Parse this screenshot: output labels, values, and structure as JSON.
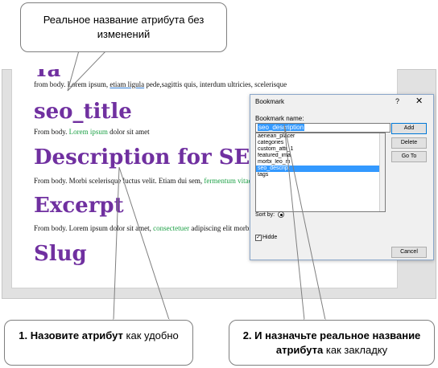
{
  "document": {
    "headings": {
      "h0": "Ya",
      "seo_title": "seo_title",
      "seo_description": "Description for SEO",
      "excerpt": "Excerpt",
      "slug": "Slug"
    },
    "lines": {
      "line1_a": "from body. Lorem ipsum, ",
      "line1_link": "etiam ligula",
      "line1_b": " pede,sagittis quis, interdum ultricies, scelerisque",
      "line2_a": "From body. ",
      "line2_green": "Lorem ipsum",
      "line2_b": " dolor sit amet",
      "line3_a": "From body. Morbi scelerisque luctus velit. Etiam dui sem, ",
      "line3_green": "fermentum vitae,",
      "line4_a": "From body. Lorem ipsum dolor sit amet, ",
      "line4_green": "consectetuer",
      "line4_b": " adipiscing elit morbi pellentesque"
    }
  },
  "dialog": {
    "title": "Bookmark",
    "help": "?",
    "close": "✕",
    "name_label": "Bookmark name:",
    "name_value": "seo_description",
    "items": [
      "aenean_placer",
      "categories",
      "custom_attr_1",
      "featured_ima",
      "morbi_leo_m",
      "seo_descript",
      "tags"
    ],
    "selected_index": 5,
    "buttons": {
      "add": "Add",
      "delete": "Delete",
      "goto": "Go To",
      "cancel": "Cancel"
    },
    "sort_by_label": "Sort by:",
    "hidden_label": "Hidde",
    "hidden_checked_mark": "✓"
  },
  "callouts": {
    "top": "Реальное название атрибута без изменений",
    "left_bold": "1. Назовите атрибут",
    "left_rest": " как удобно",
    "right_a": "2. И ",
    "right_bold": "назначьте реальное название атрибута",
    "right_rest": " как закладку"
  }
}
